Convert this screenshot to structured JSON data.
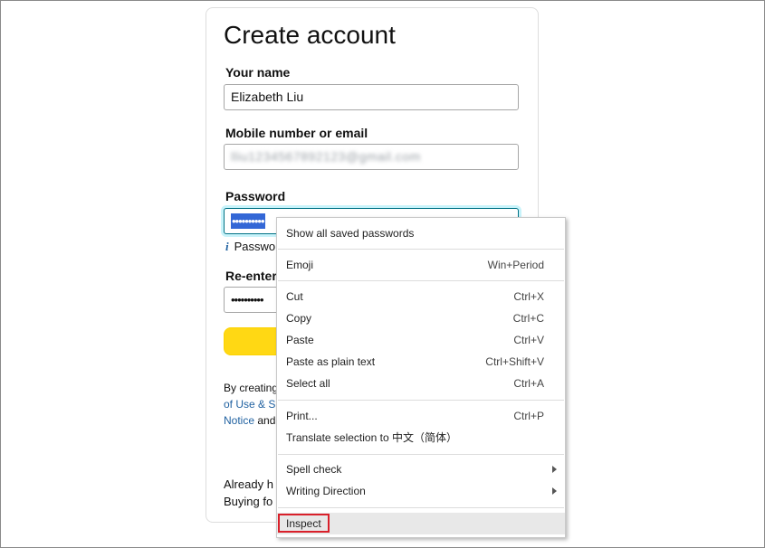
{
  "form": {
    "title": "Create account",
    "name_label": "Your name",
    "name_value": "Elizabeth Liu",
    "contact_label": "Mobile number or email",
    "contact_value": "lliu1234567892123@gmail.com",
    "password_label": "Password",
    "password_value": "••••••••••",
    "password_hint": "Passwo",
    "reenter_label": "Re-enter",
    "reenter_value": "••••••••••",
    "legal_line1": "By creating",
    "legal_line2": "of Use & S",
    "legal_line3_link": "Notice",
    "legal_line3_rest": " and",
    "bottom_line1": "Already h",
    "bottom_line2": "Buying fo"
  },
  "context_menu": {
    "items": [
      {
        "label": "Show all saved passwords",
        "shortcut": ""
      },
      {
        "label": "Emoji",
        "shortcut": "Win+Period"
      },
      {
        "label": "Cut",
        "shortcut": "Ctrl+X"
      },
      {
        "label": "Copy",
        "shortcut": "Ctrl+C"
      },
      {
        "label": "Paste",
        "shortcut": "Ctrl+V"
      },
      {
        "label": "Paste as plain text",
        "shortcut": "Ctrl+Shift+V"
      },
      {
        "label": "Select all",
        "shortcut": "Ctrl+A"
      },
      {
        "label": "Print...",
        "shortcut": "Ctrl+P"
      },
      {
        "label": "Translate selection to 中文（简体）",
        "shortcut": ""
      },
      {
        "label": "Spell check",
        "shortcut": ""
      },
      {
        "label": "Writing Direction",
        "shortcut": ""
      },
      {
        "label": "Inspect",
        "shortcut": ""
      }
    ]
  },
  "colors": {
    "accent_yellow": "#ffd814",
    "link_blue": "#2162a1",
    "focus_teal": "#007185",
    "highlight_red": "#d9202a"
  }
}
